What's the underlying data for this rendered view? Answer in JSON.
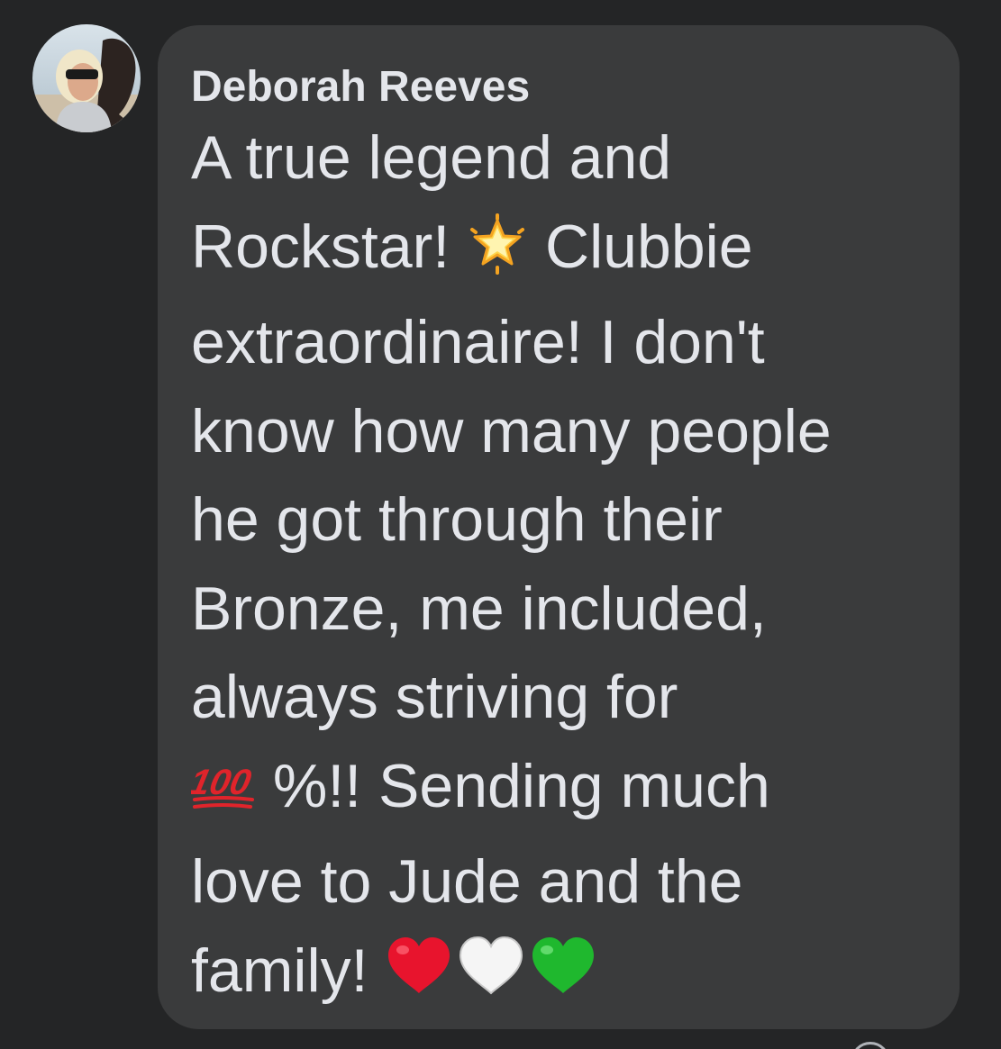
{
  "comment": {
    "author": "Deborah Reeves",
    "avatar_icon": "profile-photo",
    "text_lines": [
      [
        "A true legend and"
      ],
      [
        "Rockstar! ",
        "🌟",
        " Clubbie"
      ],
      [
        "extraordinaire! I don't"
      ],
      [
        "know how many people"
      ],
      [
        "he got through their"
      ],
      [
        "Bronze, me included,"
      ],
      [
        "always striving for"
      ],
      [
        "💯",
        " %!! Sending much"
      ],
      [
        "love to Jude and the"
      ],
      [
        "family! ",
        "❤️",
        "🤍",
        "💚"
      ]
    ],
    "emoji_names": {
      "🌟": "glowing-star",
      "💯": "hundred-points",
      "❤️": "red-heart",
      "🤍": "white-heart",
      "💚": "green-heart"
    }
  },
  "colors": {
    "background": "#242526",
    "bubble": "#3a3b3c",
    "text": "#e4e6eb"
  }
}
